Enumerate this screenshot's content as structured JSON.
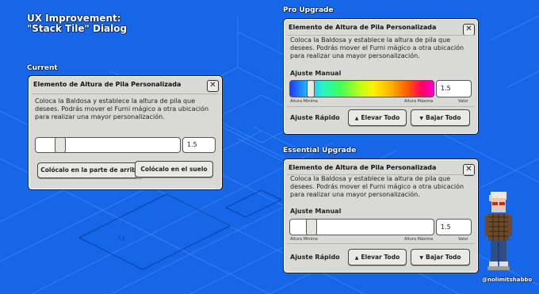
{
  "page": {
    "title_line1": "UX Improvement:",
    "title_line2": "\"Stack Tile\" Dialog",
    "credit": "@nolimitshabbo"
  },
  "sections": {
    "current": "Current",
    "pro": "Pro Upgrade",
    "essential": "Essential Upgrade"
  },
  "current_dialog": {
    "title": "Elemento de Altura de Pila Personalizada",
    "description": "Coloca la Baldosa y establece la altura de pila que desees. Podrás mover el Furni mágico a otra ubicación para realizar una mayor personalización.",
    "height_value": "1.5",
    "slider_level": 0.14,
    "btn_top": "Colócalo en la parte de arriba",
    "btn_floor": "Colócalo en el suelo"
  },
  "pro_dialog": {
    "title": "Elemento de Altura de Pila Personalizada",
    "description": "Coloca la Baldosa y establece la altura de pila que desees. Podrás mover el Furni mágico a otra ubicación para realizar una mayor personalización.",
    "manual_label": "Ajuste Manual",
    "min_label": "Altura Mínima",
    "max_label": "Altura Máxima",
    "value_label": "Valor",
    "height_value": "1.5",
    "slider_level": 0.12,
    "quick_label": "Ajuste Rápido",
    "btn_up": "Elevar Todo",
    "btn_down": "Bajar Todo"
  },
  "essential_dialog": {
    "title": "Elemento de Altura de Pila Personalizada",
    "description": "Coloca la Baldosa y establece la altura de pila que desees. Podrás mover el Furni mágico a otra ubicación para realizar una mayor personalización.",
    "manual_label": "Ajuste Manual",
    "min_label": "Altura Mínima",
    "max_label": "Altura Máxima",
    "value_label": "Valor",
    "height_value": "1.5",
    "slider_level": 0.12,
    "quick_label": "Ajuste Rápido",
    "btn_up": "Elevar Todo",
    "btn_down": "Bajar Todo"
  },
  "colors": {
    "background": "#1666e8",
    "dialog": "#d9d9d6"
  },
  "icons": {
    "close": "close-icon",
    "up": "arrow-up-icon",
    "down": "arrow-down-icon"
  }
}
